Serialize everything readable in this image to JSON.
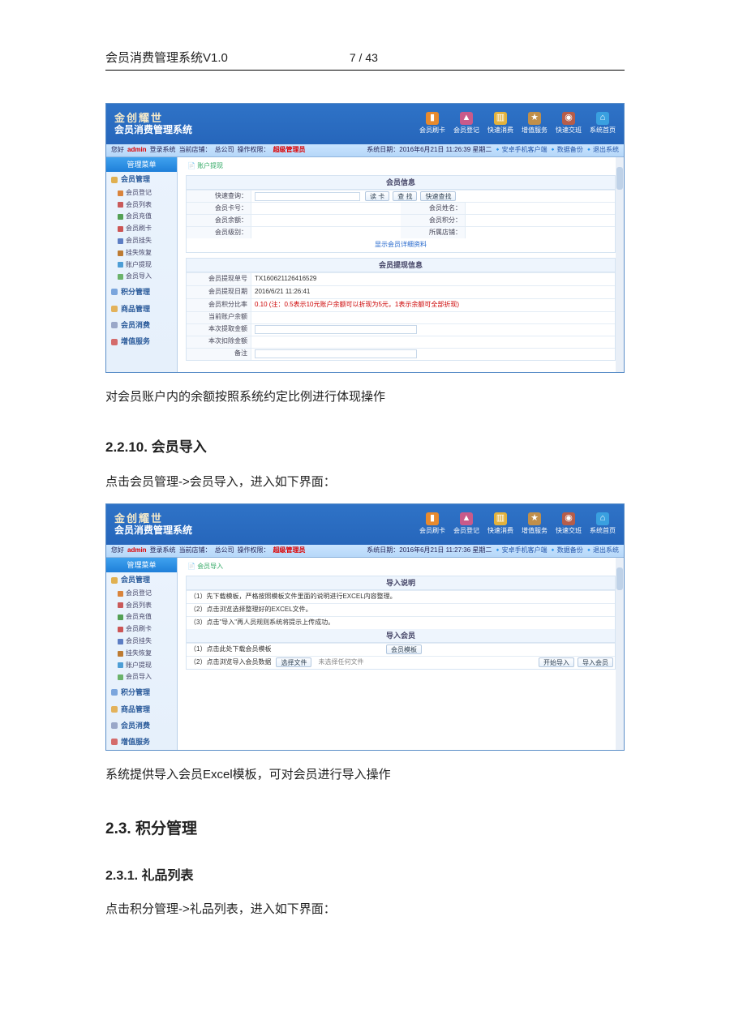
{
  "page_header": {
    "title": "会员消费管理系统V1.0",
    "page_number": "7 / 43"
  },
  "paragraphs": {
    "p1": "对会员账户内的余额按照系统约定比例进行体现操作",
    "h_2_2_10": "2.2.10.    会员导入",
    "p2": "点击会员管理->会员导入，进入如下界面：",
    "p3": "系统提供导入会员Excel模板，可对会员进行导入操作",
    "h_2_3": "2.3. 积分管理",
    "h_2_3_1": "2.3.1. 礼品列表",
    "p4": "点击积分管理->礼品列表，进入如下界面："
  },
  "app": {
    "logo_line1": "金创耀世",
    "logo_line2": "会员消费管理系统",
    "head_icons": [
      {
        "label": "会员刷卡",
        "bg": "#e78a2e",
        "glyph": "▮"
      },
      {
        "label": "会员登记",
        "bg": "#c95a8a",
        "glyph": "▲"
      },
      {
        "label": "快速消费",
        "bg": "#e2b23d",
        "glyph": "▥"
      },
      {
        "label": "增值服务",
        "bg": "#c08f4a",
        "glyph": "★"
      },
      {
        "label": "快速交班",
        "bg": "#b65d4a",
        "glyph": "◉"
      },
      {
        "label": "系统首页",
        "bg": "#3aa0e0",
        "glyph": "⌂"
      }
    ],
    "subhdr_left": [
      "您好",
      "admin",
      "登录系统",
      "当前店铺：",
      "总公司",
      "操作权限：",
      "超级管理员"
    ],
    "subhdr_right_1": "系统日期：2016年6月21日 11:26:39 星期二",
    "subhdr_right_links": [
      "安卓手机客户端",
      "数据备份",
      "退出系统"
    ],
    "nav_title": "管理菜单",
    "menu_sections": {
      "member": {
        "label": "会员管理",
        "color": "#e0b050",
        "items": [
          {
            "text": "会员登记",
            "color": "#d9843c"
          },
          {
            "text": "会员列表",
            "color": "#c95a5a"
          },
          {
            "text": "会员充值",
            "color": "#53a054"
          },
          {
            "text": "会员刷卡",
            "color": "#cc5555"
          },
          {
            "text": "会员挂失",
            "color": "#5d7ec4"
          },
          {
            "text": "挂失恢复",
            "color": "#bd7b32"
          },
          {
            "text": "账户提现",
            "color": "#4d9ed6"
          },
          {
            "text": "会员导入",
            "color": "#6bb36b"
          }
        ]
      },
      "points": {
        "label": "积分管理",
        "color": "#7aa5dd"
      },
      "goods": {
        "label": "商品管理",
        "color": "#e3b25b"
      },
      "consume": {
        "label": "会员消费",
        "color": "#9aa7c8"
      },
      "value": {
        "label": "增值服务",
        "color": "#d46b6b"
      }
    }
  },
  "screenshot1": {
    "crumb": "账户提现",
    "info_panel_title": "会员信息",
    "quick_label": "快速查询：",
    "btn_read": "读 卡",
    "btn_find": "查 找",
    "btn_quick": "快速查找",
    "row2": {
      "l1": "会员卡号：",
      "l2": "会员姓名："
    },
    "row3": {
      "l1": "会员余额：",
      "l2": "会员积分："
    },
    "row4": {
      "l1": "会员级别：",
      "l2": "所属店铺："
    },
    "more_link": "显示会员详细资料",
    "withdraw_title": "会员提现信息",
    "w_rows": {
      "r1": {
        "l": "会员提现单号",
        "v": "TX160621126416529"
      },
      "r2": {
        "l": "会员提现日期",
        "v": "2016/6/21 11:26:41"
      },
      "r3": {
        "l": "会员积分比率",
        "v": "0.10 (注：0.5表示10元账户余额可以折现为5元，1表示余额可全部折现)"
      },
      "r4": {
        "l": "当前账户余额",
        "v": ""
      },
      "r5": {
        "l": "本次提取金额",
        "v": ""
      },
      "r6": {
        "l": "本次扣除金额",
        "v": ""
      },
      "r7": {
        "l": "备注",
        "v": ""
      }
    }
  },
  "screenshot2": {
    "subhdr_right_1": "系统日期：2016年6月21日 11:27:36 星期二",
    "crumb": "会员导入",
    "explain_title": "导入说明",
    "exp1": "（1）先下载模板，严格按照模板文件里面的说明进行EXCEL内容整理。",
    "exp2": "（2）点击浏览选择整理好的EXCEL文件。",
    "exp3": "（3）点击\"导入\"再人员规则系统将提示上传成功。",
    "import_title": "导入会员",
    "row1_label": "（1）点击此处下载会员模板",
    "row1_btn": "会员模板",
    "row2_label": "（2）点击浏览导入会员数据",
    "row2_btn_browse": "选择文件",
    "row2_placeholder": "未选择任何文件",
    "row2_btn_start": "开始导入",
    "row2_btn_import": "导入会员"
  }
}
